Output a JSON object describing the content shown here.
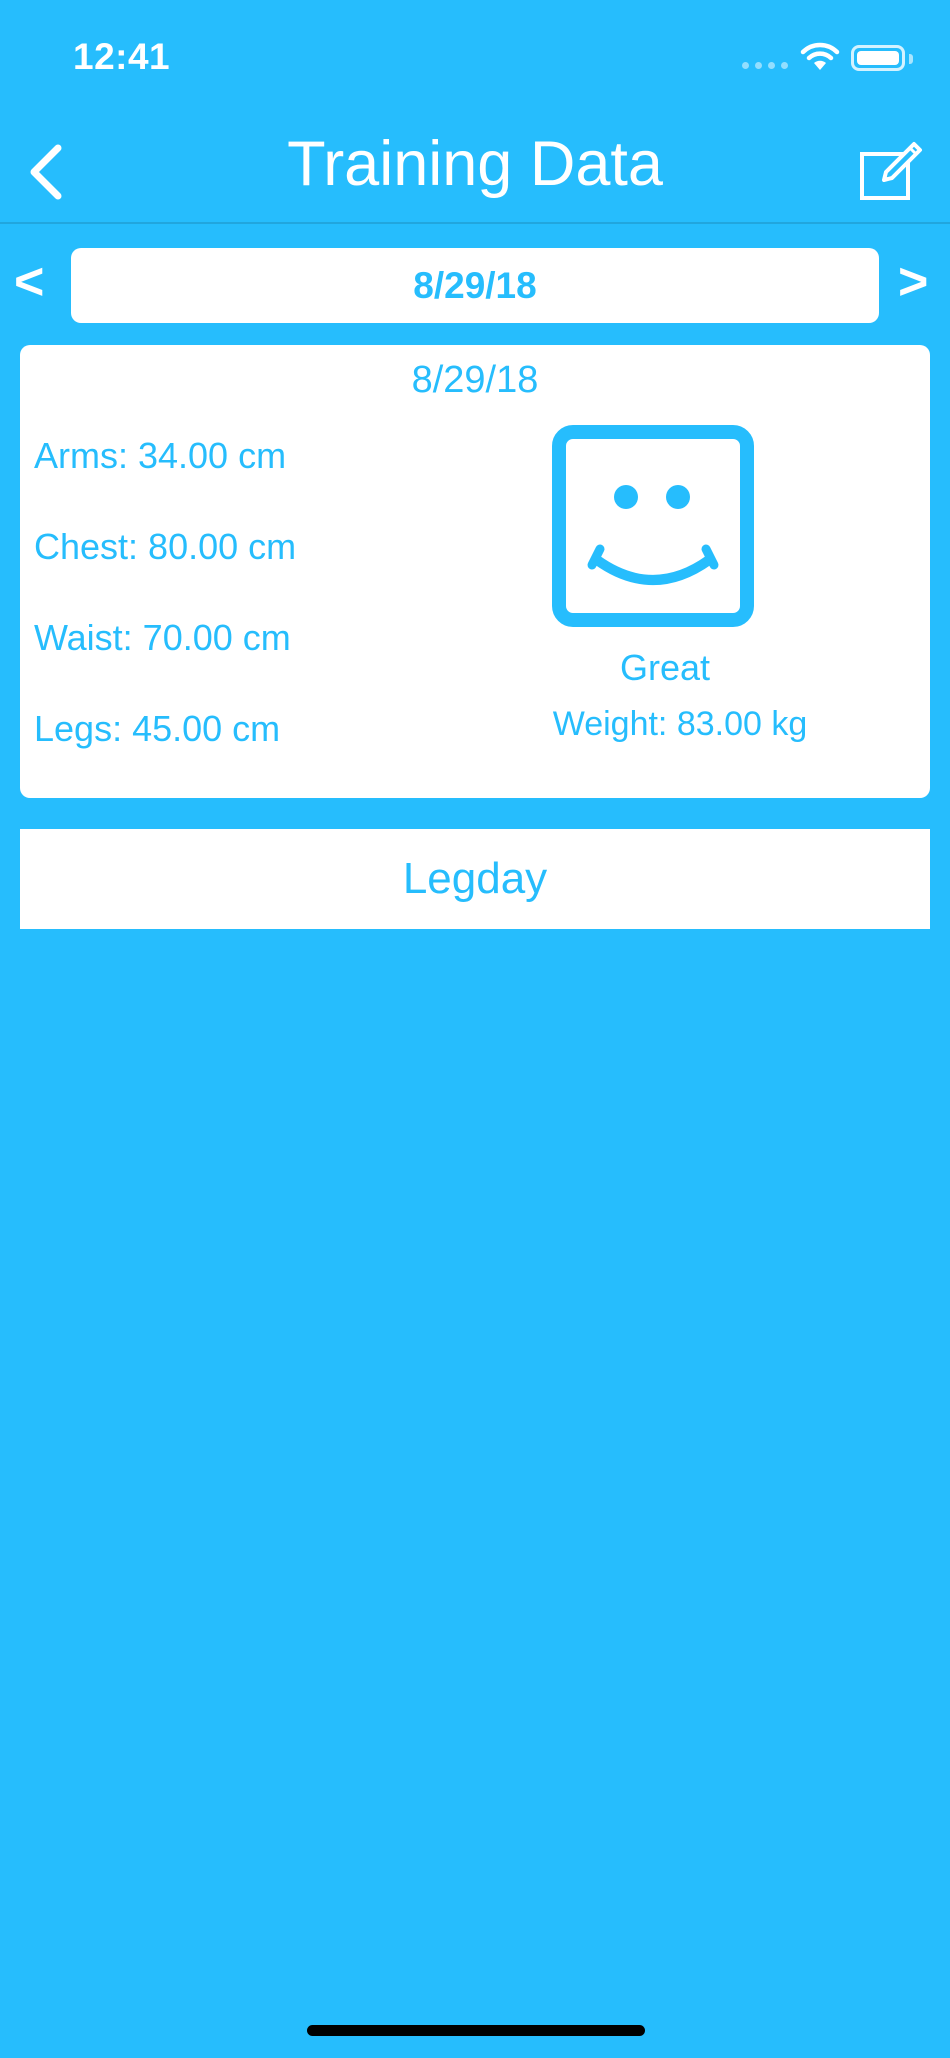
{
  "status_bar": {
    "time": "12:41"
  },
  "nav": {
    "title": "Training Data",
    "back_icon": "chevron-left-icon",
    "edit_icon": "edit-icon"
  },
  "date_selector": {
    "prev_label": "<",
    "next_label": ">",
    "date": "8/29/18"
  },
  "entry": {
    "date": "8/29/18",
    "measurements": [
      {
        "text": "Arms: 34.00 cm"
      },
      {
        "text": "Chest: 80.00 cm"
      },
      {
        "text": "Waist: 70.00 cm"
      },
      {
        "text": "Legs: 45.00 cm"
      }
    ],
    "mood_icon": "smiley-face-icon",
    "mood": "Great",
    "weight": "Weight: 83.00 kg"
  },
  "workout": {
    "label": "Legday"
  },
  "colors": {
    "background": "#26BDFD",
    "accent": "#26BDFD",
    "card": "#FFFFFF"
  }
}
